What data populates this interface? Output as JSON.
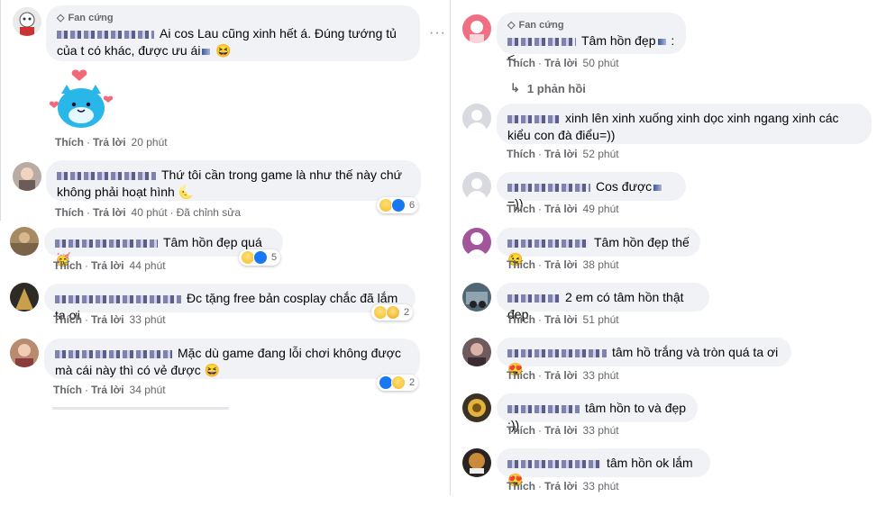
{
  "badge_label": "Fan cứng",
  "actions": {
    "like": "Thích",
    "reply": "Trả lời",
    "edited": "Đã chỉnh sửa"
  },
  "left": [
    {
      "text": "Ai cos Lau cũng xinh hết á. Đúng tướng tủ của t có khác, được ưu ái",
      "emoji": "😆",
      "time": "20 phút"
    },
    {
      "text": "Thứ tôi cần trong game là như thế này chứ không phải hoạt hình",
      "emoji": "🌜",
      "time": "40 phút",
      "reactions": "6"
    },
    {
      "text": "Tâm hồn đẹp quá",
      "emoji": "🥳",
      "time": "44 phút",
      "reactions": "5"
    },
    {
      "text": "Đc tặng free bản cosplay chắc đã lắm ta ơi",
      "time": "33 phút",
      "reactions": "2"
    },
    {
      "text": "Mặc dù game đang lỗi chơi không được mà cái này thì có vẻ được",
      "emoji": "😆",
      "time": "34 phút",
      "reactions": "2"
    }
  ],
  "right": [
    {
      "text": "Tâm hồn đẹp",
      "suffix": ":<",
      "time": "50 phút"
    },
    {
      "text": "xinh lên xinh xuống xinh dọc xinh ngang xinh các kiểu con đà điểu=))",
      "time": "52 phút"
    },
    {
      "text": "Cos được",
      "suffix": "=))",
      "time": "49 phút"
    },
    {
      "text": "Tâm hồn đẹp thế",
      "emoji": "😉",
      "time": "38 phút"
    },
    {
      "text": "2 em có tâm hồn thật đẹp.",
      "time": "51 phút"
    },
    {
      "text": "tâm hồ trắng và tròn quá ta ơi",
      "emoji": "😍",
      "time": "33 phút"
    },
    {
      "text": "tâm hồn to và đẹp :))",
      "time": "33 phút"
    },
    {
      "text": "tâm hồn ok lắm",
      "emoji": "😍",
      "time": "33 phút"
    }
  ],
  "replies_link": "1 phản hồi",
  "colors": {
    "bubble": "#f0f2f5",
    "meta": "#65676b",
    "like_blue": "#1877f2"
  }
}
